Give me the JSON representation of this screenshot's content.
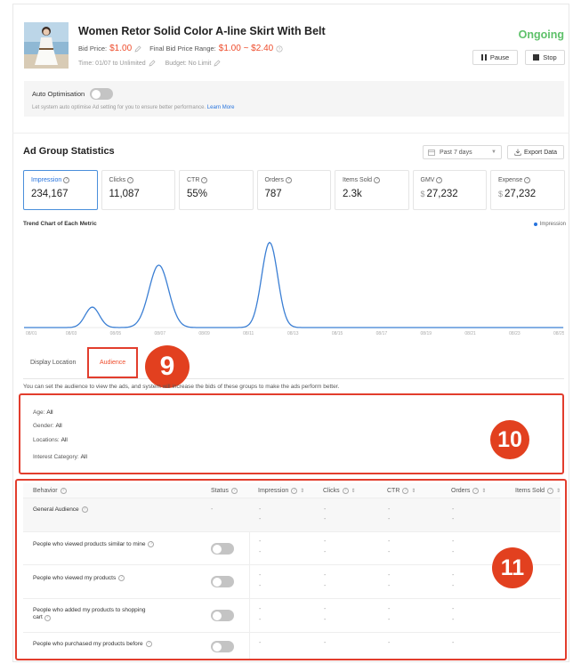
{
  "product": {
    "title": "Women Retor Solid Color A-line Skirt With Belt",
    "bid_price_label": "Bid Price:",
    "bid_price": "$1.00",
    "final_range_label": "Final Bid Price Range:",
    "final_range": "$1.00 ~ $2.40",
    "time": "Time: 01/07 to Unlimited",
    "budget": "Budget: No Limit",
    "status": "Ongoing",
    "pause_label": "Pause",
    "stop_label": "Stop"
  },
  "auto_opt": {
    "label": "Auto Optimisation",
    "desc": "Let system auto optimise Ad setting for you to ensure better performance.",
    "link": "Learn More"
  },
  "stats": {
    "title": "Ad Group Statistics",
    "date_range": "Past 7 days",
    "export_label": "Export Data",
    "cards": [
      {
        "label": "Impression",
        "value": "234,167",
        "currency": ""
      },
      {
        "label": "Clicks",
        "value": "11,087",
        "currency": ""
      },
      {
        "label": "CTR",
        "value": "55%",
        "currency": ""
      },
      {
        "label": "Orders",
        "value": "787",
        "currency": ""
      },
      {
        "label": "Items Sold",
        "value": "2.3k",
        "currency": ""
      },
      {
        "label": "GMV",
        "value": "27,232",
        "currency": "$"
      },
      {
        "label": "Expense",
        "value": "27,232",
        "currency": "$"
      }
    ]
  },
  "chart_data": {
    "type": "line",
    "title": "Trend Chart of Each Metric",
    "x": [
      "08/01",
      "08/03",
      "08/05",
      "08/07",
      "08/09",
      "08/11",
      "08/13",
      "08/15",
      "08/17",
      "08/19",
      "08/21",
      "08/23",
      "08/25"
    ],
    "series": [
      {
        "name": "Impression",
        "values": [
          0,
          0,
          18,
          0,
          0,
          0,
          0,
          0,
          0,
          0,
          0,
          0,
          0
        ]
      }
    ],
    "peaks": [
      {
        "x": "08/04",
        "value": 18
      },
      {
        "x": "08/07",
        "value": 55
      },
      {
        "x": "08/12",
        "value": 75
      }
    ],
    "ylim": [
      0,
      80
    ],
    "color": "#3b7fd4",
    "grid": false,
    "legend": "top-right"
  },
  "tabs": {
    "display": "Display Location",
    "audience": "Audience"
  },
  "badges": {
    "b9": "9",
    "b10": "10",
    "b11": "11"
  },
  "audience": {
    "desc": "You can set the audience to view the ads, and system will increase the bids of these groups to make the ads perform better.",
    "age_label": "Age:",
    "age": "All",
    "gender_label": "Gender:",
    "gender": "All",
    "locations_label": "Locations:",
    "locations": "All",
    "interest_label": "Interest Category:",
    "interest": "All"
  },
  "table": {
    "headers": [
      "Behavior",
      "Status",
      "Impression",
      "Clicks",
      "CTR",
      "Orders",
      "Items Sold"
    ],
    "rows": [
      {
        "behavior": "General Audience",
        "status": "-"
      },
      {
        "behavior": "People who viewed products similar to mine",
        "status": "toggle"
      },
      {
        "behavior": "People who viewed my products",
        "status": "toggle"
      },
      {
        "behavior": "People who added my products to shopping",
        "behavior2": "cart",
        "status": "toggle"
      },
      {
        "behavior": "People who purchased my products before",
        "status": "toggle"
      }
    ],
    "dash": "-"
  },
  "colors": {
    "accent": "#ee4d2d",
    "status": "#5ec16a",
    "link": "#2673dd",
    "highlight": "#e23d2d"
  }
}
